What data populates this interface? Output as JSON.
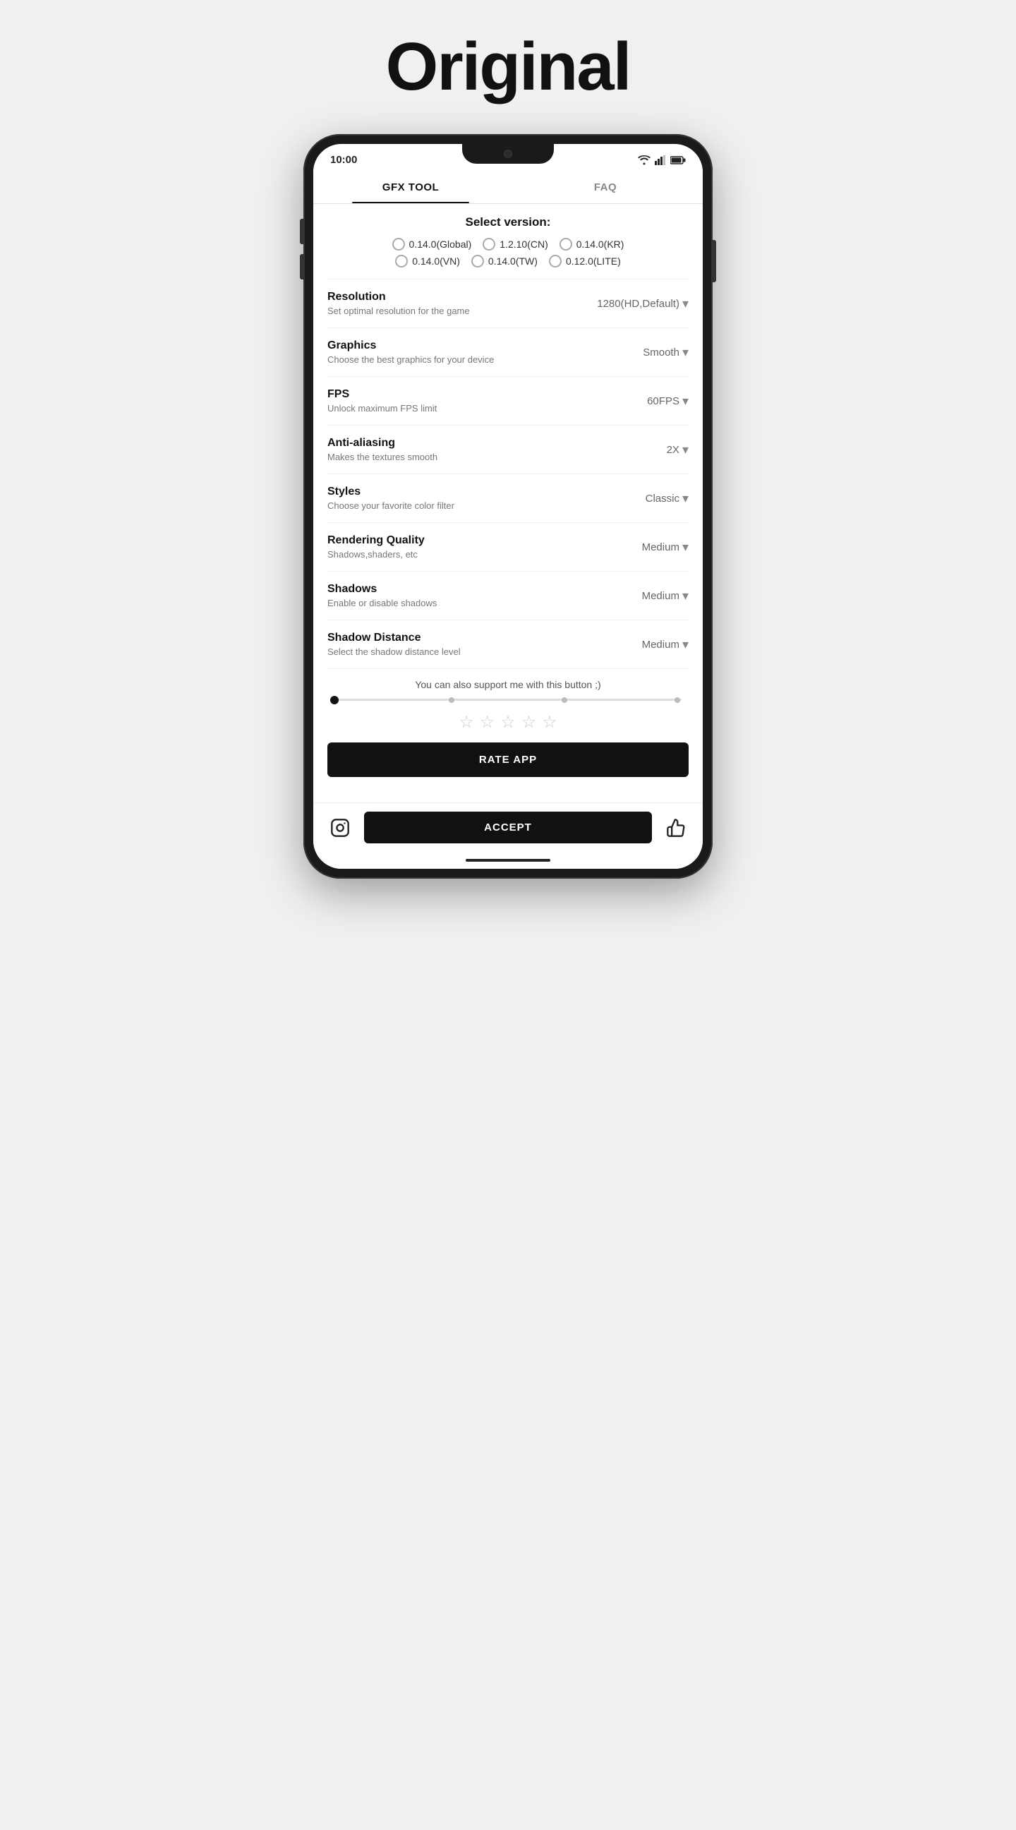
{
  "header": {
    "title": "Original"
  },
  "status_bar": {
    "time": "10:00"
  },
  "tabs": [
    {
      "label": "GFX TOOL",
      "active": true
    },
    {
      "label": "FAQ",
      "active": false
    }
  ],
  "version_section": {
    "title": "Select version:",
    "options": [
      {
        "label": "0.14.0(Global)",
        "selected": false
      },
      {
        "label": "1.2.10(CN)",
        "selected": false
      },
      {
        "label": "0.14.0(KR)",
        "selected": false
      },
      {
        "label": "0.14.0(VN)",
        "selected": false
      },
      {
        "label": "0.14.0(TW)",
        "selected": false
      },
      {
        "label": "0.12.0(LITE)",
        "selected": false
      }
    ]
  },
  "settings": [
    {
      "name": "Resolution",
      "desc": "Set optimal resolution for the game",
      "value": "1280(HD,Default)"
    },
    {
      "name": "Graphics",
      "desc": "Choose the best graphics for your device",
      "value": "Smooth"
    },
    {
      "name": "FPS",
      "desc": "Unlock maximum FPS limit",
      "value": "60FPS"
    },
    {
      "name": "Anti-aliasing",
      "desc": "Makes the textures smooth",
      "value": "2X"
    },
    {
      "name": "Styles",
      "desc": "Choose your favorite color filter",
      "value": "Classic"
    },
    {
      "name": "Rendering Quality",
      "desc": "Shadows,shaders, etc",
      "value": "Medium"
    },
    {
      "name": "Shadows",
      "desc": "Enable or disable shadows",
      "value": "Medium"
    },
    {
      "name": "Shadow Distance",
      "desc": "Select the shadow distance level",
      "value": "Medium"
    }
  ],
  "support": {
    "text": "You can also support me with this button ;)"
  },
  "stars": [
    "☆",
    "☆",
    "☆",
    "☆",
    "☆"
  ],
  "buttons": {
    "rate_app": "RATE APP",
    "accept": "ACCEPT"
  }
}
